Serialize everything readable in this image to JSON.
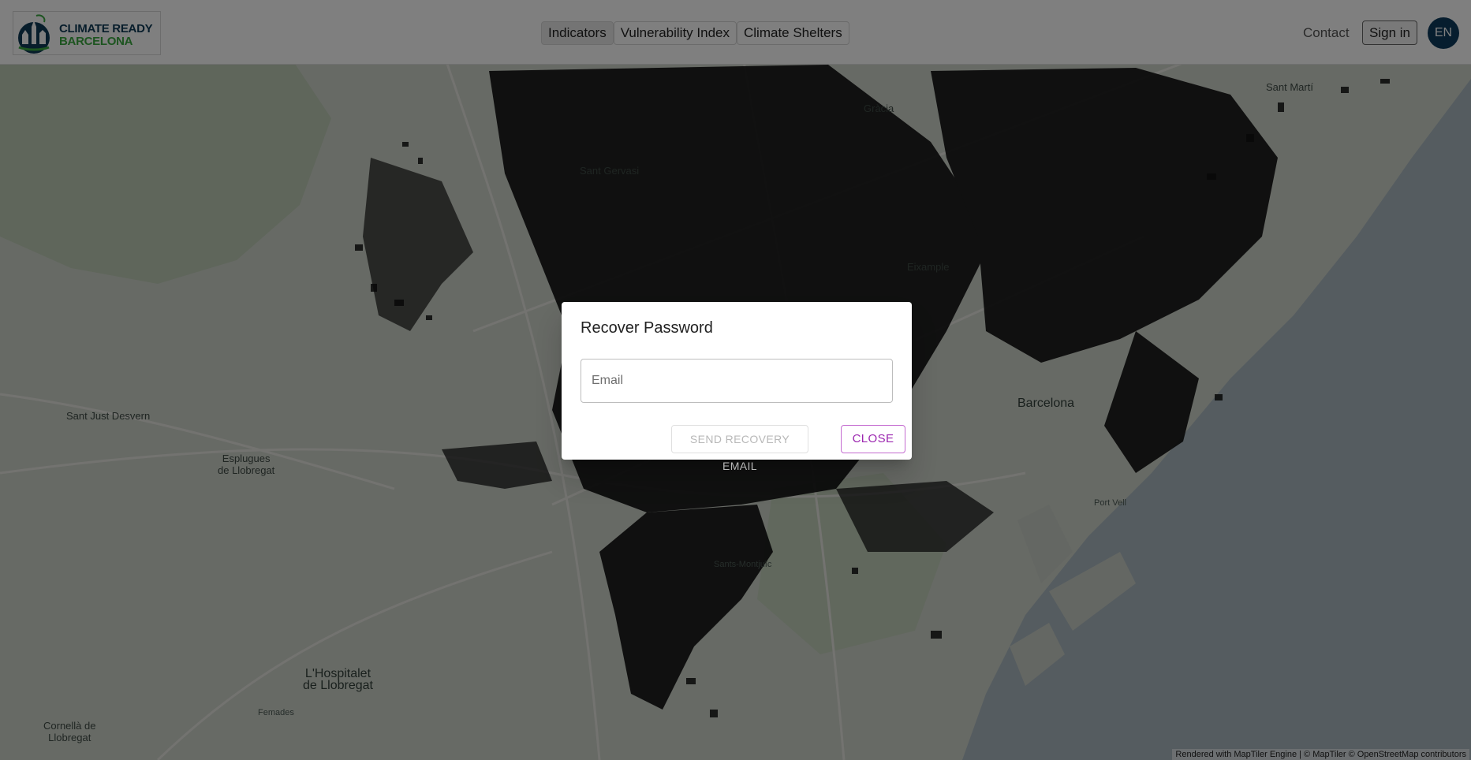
{
  "header": {
    "logo": {
      "line1": "CLIMATE READY",
      "line2": "BARCELONA"
    },
    "nav": [
      {
        "label": "Indicators",
        "active": true
      },
      {
        "label": "Vulnerability Index",
        "active": false
      },
      {
        "label": "Climate Shelters",
        "active": false
      }
    ],
    "contact_label": "Contact",
    "signin_label": "Sign in",
    "language": "EN"
  },
  "map": {
    "labels": {
      "sant_marti": "Sant Martí",
      "gracia": "Gràcia",
      "sant_gervasi": "Sant Gervasi",
      "eixample": "Eixample",
      "barcelona": "Barcelona",
      "sant_just": "Sant Just Desvern",
      "esplugues_1": "Esplugues",
      "esplugues_2": "de Llobregat",
      "port_vell": "Port Vell",
      "sants_montjuic": "Sants-Montjuïc",
      "hospitalet_1": "L'Hospitalet",
      "hospitalet_2": "de Llobregat",
      "femades": "Femades",
      "cornella_1": "Cornellà de",
      "cornella_2": "Llobregat"
    },
    "attribution": "Rendered with MapTiler Engine | © MapTiler © OpenStreetMap contributors"
  },
  "dialog": {
    "title": "Recover Password",
    "email_placeholder": "Email",
    "email_value": "",
    "send_label": "SEND RECOVERY EMAIL",
    "close_label": "CLOSE"
  },
  "colors": {
    "brand_blue": "#0d3a5c",
    "brand_green": "#3aa940",
    "accent_purple": "#9c27b0"
  }
}
